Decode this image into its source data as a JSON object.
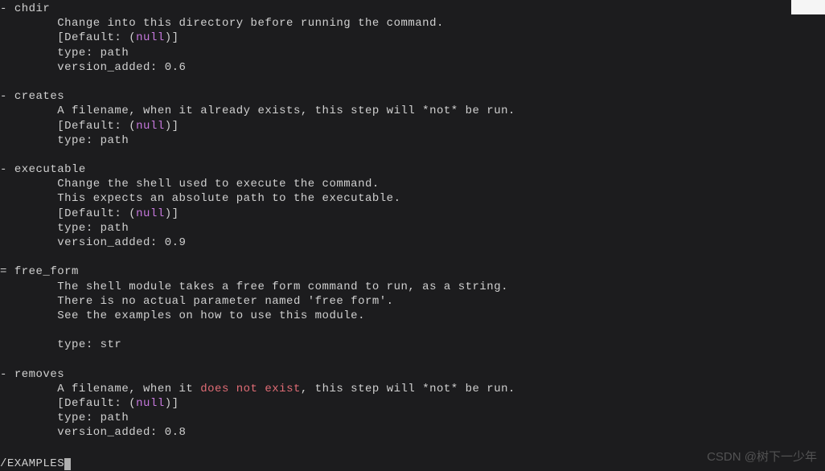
{
  "options": [
    {
      "marker": "-",
      "name": "chdir",
      "lines": [
        "Change into this directory before running the command.",
        {
          "default": true
        },
        "type: path",
        "version_added: 0.6"
      ]
    },
    {
      "marker": "-",
      "name": "creates",
      "lines": [
        "A filename, when it already exists, this step will *not* be run.",
        {
          "default": true
        },
        "type: path"
      ]
    },
    {
      "marker": "-",
      "name": "executable",
      "lines": [
        "Change the shell used to execute the command.",
        "This expects an absolute path to the executable.",
        {
          "default": true
        },
        "type: path",
        "version_added: 0.9"
      ]
    },
    {
      "marker": "=",
      "name": "free_form",
      "lines": [
        "The shell module takes a free form command to run, as a string.",
        "There is no actual parameter named 'free form'.",
        "See the examples on how to use this module.",
        "",
        "type: str"
      ]
    },
    {
      "marker": "-",
      "name": "removes",
      "lines": [
        {
          "segments": [
            "A filename, when it ",
            {
              "hl": "does not exist"
            },
            ", this step will *not* be run."
          ]
        },
        {
          "default": true
        },
        "type: path",
        "version_added: 0.8"
      ]
    }
  ],
  "defaultLabel": "[Default: ",
  "defaultNull": "null",
  "defaultClose": "]",
  "search": "/EXAMPLES",
  "watermark": "CSDN @树下一少年"
}
